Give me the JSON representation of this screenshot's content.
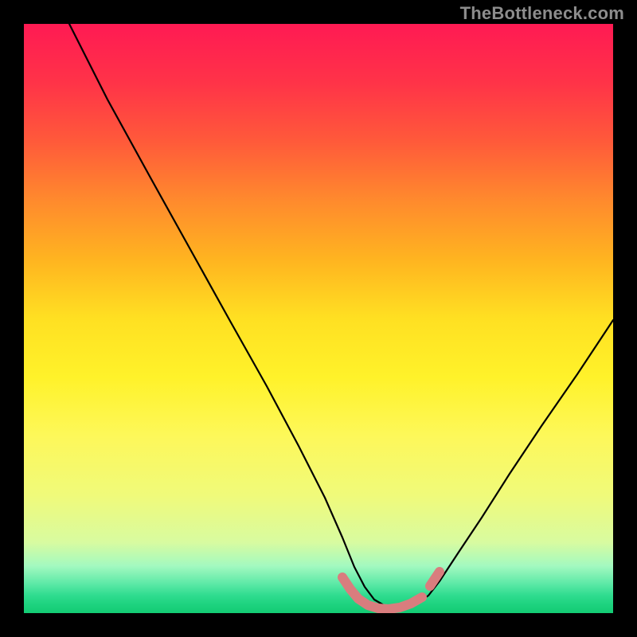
{
  "watermark": "TheBottleneck.com",
  "chart_data": {
    "type": "line",
    "title": "",
    "xlabel": "",
    "ylabel": "",
    "x": [
      0.0,
      0.05,
      0.1,
      0.15,
      0.2,
      0.25,
      0.3,
      0.35,
      0.4,
      0.45,
      0.5,
      0.55,
      0.575,
      0.6,
      0.625,
      0.65,
      0.675,
      0.7,
      0.75,
      0.8,
      0.85,
      0.9,
      0.95,
      1.0
    ],
    "values": [
      1.0,
      0.91,
      0.83,
      0.74,
      0.66,
      0.57,
      0.49,
      0.4,
      0.32,
      0.23,
      0.14,
      0.055,
      0.025,
      0.01,
      0.005,
      0.005,
      0.01,
      0.04,
      0.12,
      0.22,
      0.32,
      0.42,
      0.48,
      0.5
    ],
    "xlim": [
      0,
      1
    ],
    "ylim": [
      0,
      1
    ],
    "series": [
      {
        "name": "bottleneck-curve",
        "color": "#000000"
      }
    ],
    "highlight": {
      "name": "optimal-range",
      "color": "#d97d7e",
      "x": [
        0.54,
        0.56,
        0.58,
        0.6,
        0.62,
        0.64,
        0.66,
        0.68,
        0.7
      ],
      "values": [
        0.06,
        0.035,
        0.018,
        0.01,
        0.007,
        0.007,
        0.012,
        0.03,
        0.05
      ]
    },
    "background_gradient": {
      "top": "#ff1a53",
      "mid": "#fff22a",
      "bottom": "#13cb74"
    }
  }
}
